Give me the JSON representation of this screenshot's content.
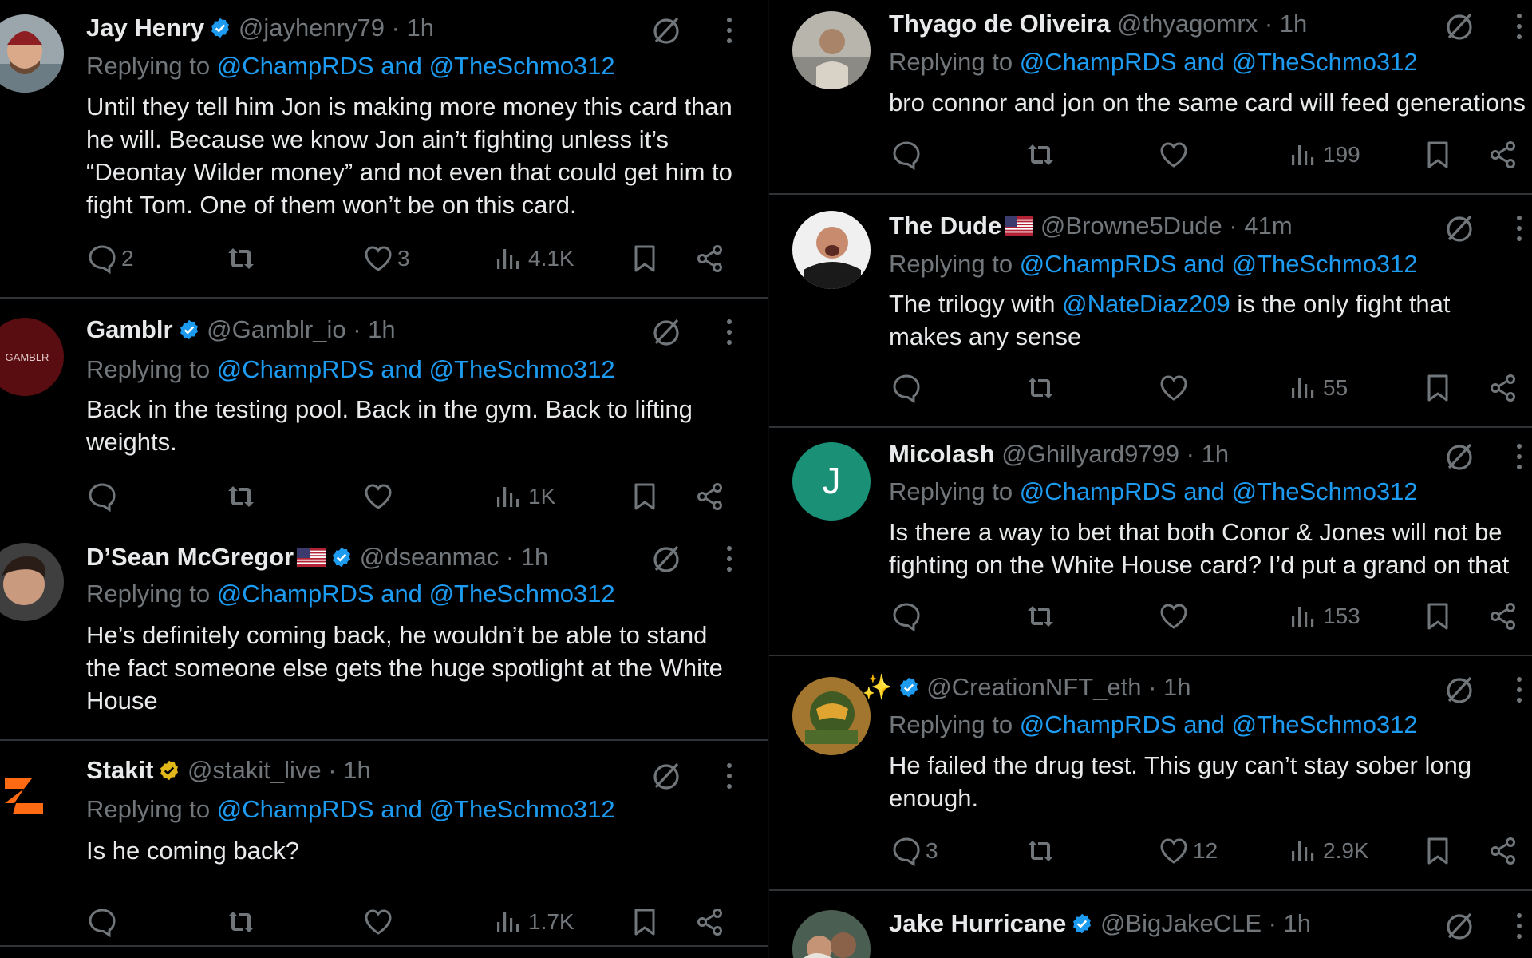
{
  "replying_label": "Replying to",
  "colors": {
    "background": "#000000",
    "text": "#e7e9ea",
    "muted": "#71767b",
    "link": "#1d9bf0",
    "verified_blue": "#1d9bf0",
    "verified_gold": "#e2b719",
    "divider": "#2f3336"
  },
  "icons": {
    "actions": [
      "reply-icon",
      "retweet-icon",
      "like-icon",
      "views-icon",
      "bookmark-icon",
      "share-icon"
    ],
    "header": [
      "grok-icon",
      "more-icon"
    ]
  },
  "tweets": [
    {
      "name": "Jay Henry",
      "verified": "blue",
      "handle": "@jayhenry79",
      "time": "· 1h",
      "reply_a": "@ChampRDS",
      "reply_and": "and",
      "reply_b": "@TheSchmo312",
      "text": "Until they tell him Jon is making more money this card than he will. Because we know Jon ain’t fighting unless it’s “Deontay Wilder money” and not even that could get him to fight Tom. One of them won’t be on this card.",
      "replies": "2",
      "retweets": "",
      "likes": "3",
      "views": "4.1K"
    },
    {
      "name": "Gamblr",
      "verified": "blue",
      "handle": "@Gamblr_io",
      "time": "· 1h",
      "reply_a": "@ChampRDS",
      "reply_and": "and",
      "reply_b": "@TheSchmo312",
      "text": "Back in the testing pool. Back in the gym. Back to lifting weights.",
      "replies": "",
      "retweets": "",
      "likes": "",
      "views": "1K",
      "avatar_text": "GAMBLR"
    },
    {
      "name": "D’Sean McGregor",
      "verified": "blue",
      "handle": "@dseanmac",
      "time": "· 1h",
      "reply_a": "@ChampRDS",
      "reply_and": "and",
      "reply_b": "@TheSchmo312",
      "text": "He’s definitely coming back, he wouldn’t be able to stand the fact someone else gets the huge spotlight at the White House",
      "replies": "",
      "retweets": "",
      "likes": "",
      "views": ""
    },
    {
      "name": "Stakit",
      "verified": "gold",
      "handle": "@stakit_live",
      "time": "· 1h",
      "reply_a": "@ChampRDS",
      "reply_and": "and",
      "reply_b": "@TheSchmo312",
      "text": "Is he coming back?",
      "replies": "",
      "retweets": "",
      "likes": "",
      "views": "1.7K"
    },
    {
      "name": "Thyago de Oliveira",
      "handle": "@thyagomrx",
      "time": "· 1h",
      "reply_a": "@ChampRDS",
      "reply_and": "and",
      "reply_b": "@TheSchmo312",
      "text": "bro connor and jon on the same card will feed generations",
      "replies": "",
      "retweets": "",
      "likes": "",
      "views": "199"
    },
    {
      "name": "The Dude",
      "handle": "@Browne5Dude",
      "time": "· 41m",
      "reply_a": "@ChampRDS",
      "reply_and": "and",
      "reply_b": "@TheSchmo312",
      "text_pre": "The trilogy with",
      "text_mention": "@NateDiaz209",
      "text_post": "is the only fight that makes any sense",
      "replies": "",
      "retweets": "",
      "likes": "",
      "views": "55"
    },
    {
      "name": "Micolash",
      "handle": "@Ghillyard9799",
      "time": "· 1h",
      "reply_a": "@ChampRDS",
      "reply_and": "and",
      "reply_b": "@TheSchmo312",
      "text": "Is there a way to bet that both Conor & Jones will not be fighting on the White House card? I’d put a grand on that",
      "replies": "",
      "retweets": "",
      "likes": "",
      "views": "153",
      "avatar_text": "J"
    },
    {
      "name": "✨",
      "verified": "blue",
      "handle": "@CreationNFT_eth",
      "time": "· 1h",
      "reply_a": "@ChampRDS",
      "reply_and": "and",
      "reply_b": "@TheSchmo312",
      "text": "He failed the drug test. This guy can’t stay sober long enough.",
      "replies": "3",
      "retweets": "",
      "likes": "12",
      "views": "2.9K"
    },
    {
      "name": "Jake Hurricane",
      "verified": "blue",
      "handle": "@BigJakeCLE",
      "time": "· 1h"
    }
  ]
}
